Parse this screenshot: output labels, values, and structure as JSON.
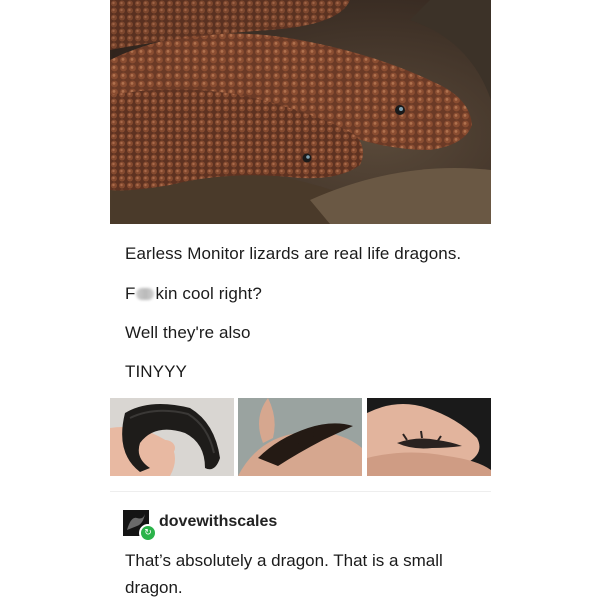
{
  "post": {
    "hero_image": {
      "alt": "earless-monitor-lizards-photo"
    },
    "lines": {
      "line1": "Earless Monitor lizards are real life dragons.",
      "line2_prefix": "F",
      "line2_suffix": "kin cool right?",
      "line3": "Well they're also",
      "line4": "TINYYY"
    },
    "thumbnails": [
      {
        "alt": "lizard-on-hand-1"
      },
      {
        "alt": "lizard-on-hand-2"
      },
      {
        "alt": "lizard-on-hand-3"
      }
    ]
  },
  "reblog": {
    "username": "dovewithscales",
    "badge_icon": "reblog-icon",
    "comment": "That’s absolutely a dragon. That is a small dragon."
  },
  "colors": {
    "reblog_green": "#2bb34a",
    "lizard_brown": "#6b3a26"
  }
}
